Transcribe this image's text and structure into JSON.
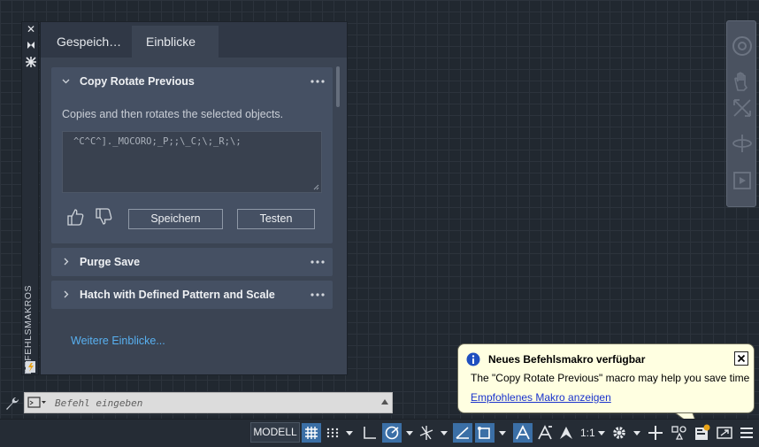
{
  "palette": {
    "vertical_title": "BEFEHLSMAKROS",
    "tabs": [
      {
        "label": "Gespeich…",
        "active": false
      },
      {
        "label": "Einblicke",
        "active": true
      }
    ],
    "cards": [
      {
        "title": "Copy Rotate Previous",
        "expanded": true,
        "description": "Copies and then rotates the selected objects.",
        "macro": "^C^C^]._MOCORO;_P;;\\_C;\\;_R;\\;",
        "save_label": "Speichern",
        "test_label": "Testen"
      },
      {
        "title": "Purge Save",
        "expanded": false
      },
      {
        "title": "Hatch with Defined Pattern and Scale",
        "expanded": false
      }
    ],
    "more_link": "Weitere Einblicke..."
  },
  "command_line": {
    "placeholder": "Befehl eingeben"
  },
  "statusbar": {
    "model_label": "MODELL",
    "annotation_scale": "1:1"
  },
  "notification": {
    "title": "Neues Befehlsmakro verfügbar",
    "message": "The \"Copy Rotate Previous\" macro may help you save time",
    "link": "Empfohlenes Makro anzeigen"
  },
  "colors": {
    "canvas": "#212830",
    "panel": "#3b4453",
    "card": "#455063",
    "accent_blue": "#3b6fa6",
    "link_blue": "#58b0f0",
    "balloon_bg": "#ffffe1"
  }
}
